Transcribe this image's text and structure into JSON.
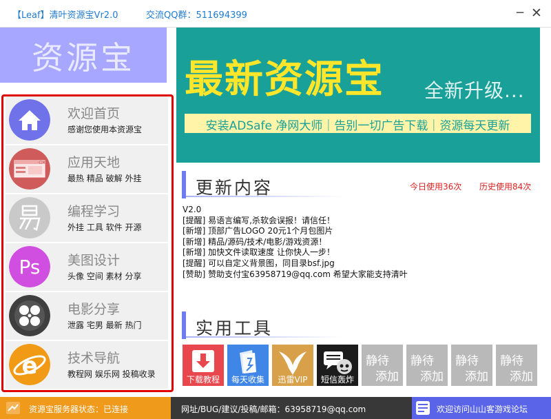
{
  "window": {
    "app_title": "【Leaf】清叶资源宝Vr2.0",
    "qq_group": "交流QQ群：511694399",
    "minimize_glyph": "─",
    "close_glyph": "✕"
  },
  "logo": {
    "text": "资源宝"
  },
  "sidebar": {
    "items": [
      {
        "title": "欢迎首页",
        "subtitle": "感谢您使用本资源宝",
        "icon": "home-icon",
        "color": "#6f72e8"
      },
      {
        "title": "应用天地",
        "subtitle": "最热 精品 破解 外挂",
        "icon": "app-window-icon",
        "color": "#cf5b5b"
      },
      {
        "title": "编程学习",
        "subtitle": "外挂 工具 软件 开源",
        "icon": "easy-language-icon",
        "color": "#c9c9c9"
      },
      {
        "title": "美图设计",
        "subtitle": "头像 空间 素材 分享",
        "icon": "photoshop-icon",
        "color": "#d14fe0"
      },
      {
        "title": "电影分享",
        "subtitle": "泄露 宅男 最新 热门",
        "icon": "film-reel-icon",
        "color": "#3f3f3f"
      },
      {
        "title": "技术导航",
        "subtitle": "教程网 娱乐网 投稿收录",
        "icon": "ie-browser-icon",
        "color": "#f19a16"
      }
    ]
  },
  "banner": {
    "headline": "最新资源宝",
    "tagline": "全新升级...",
    "slogan": "安装ADSafe 净网大师｜告别一切广告下载｜资源每天更新"
  },
  "updates": {
    "heading": "更新内容",
    "today_usage": "今日使用36次",
    "total_usage": "历史使用84次",
    "lines": [
      "V2.0",
      "[提醒]  易语言编写,杀软会误报！请信任！",
      "[新增]  顶部广告LOGO  20元1个月包图片",
      "[新增]  精品/源码/技术/电影/游戏资源！",
      "[新增]  加快文件读取速度  让你快人一步！",
      "[提醒]  可以自定义背景图，同目录bsf.jpg",
      "[赞助]  赞助支付宝63958719@qq.com  希望大家能支持清叶"
    ]
  },
  "tools": {
    "heading": "实用工具",
    "items": [
      {
        "label": "下载教程",
        "icon": "download-icon",
        "color": "#e8474e"
      },
      {
        "label": "每天收集",
        "icon": "book-stack-icon",
        "color": "#3f86e6"
      },
      {
        "label": "迅雷VIP",
        "icon": "thunder-bird-icon",
        "color": "#d9a04a"
      },
      {
        "label": "短信轰炸",
        "icon": "bomb-message-icon",
        "color": "#1c1c1c"
      }
    ],
    "placeholders": [
      {
        "line1": "静待",
        "line2": "添加"
      },
      {
        "line1": "静待",
        "line2": "添加"
      },
      {
        "line1": "静待",
        "line2": "添加"
      },
      {
        "line1": "静待",
        "line2": "添加"
      }
    ]
  },
  "statusbar": {
    "server_status": "资源宝服务器状态：已连接",
    "contact": "网址/BUG/建议/投稿/邮箱：63958719@qq.com",
    "forum_link": "欢迎访问山山客游戏论坛"
  }
}
